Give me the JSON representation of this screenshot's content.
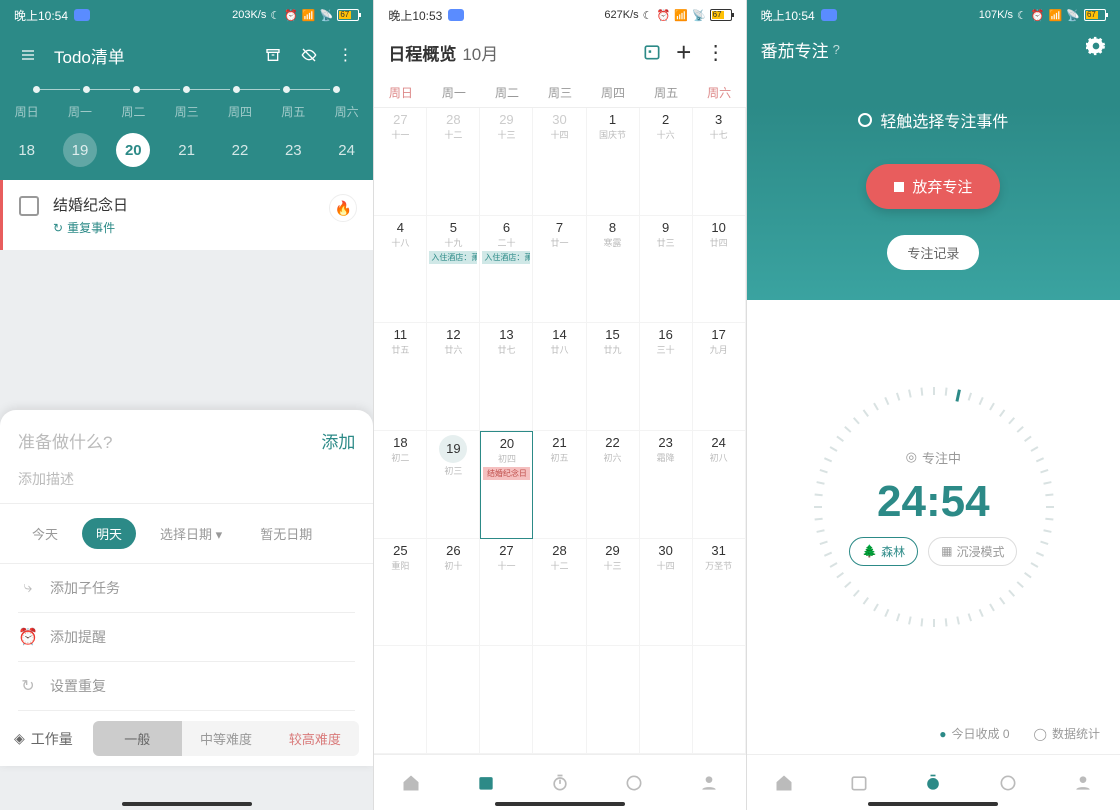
{
  "phone1": {
    "status": {
      "time": "晚上10:54",
      "net": "203K/s"
    },
    "topbar": {
      "title": "Todo清单"
    },
    "weekdays": [
      "周日",
      "周一",
      "周二",
      "周三",
      "周四",
      "周五",
      "周六"
    ],
    "dates": [
      "18",
      "19",
      "20",
      "21",
      "22",
      "23",
      "24"
    ],
    "todo": {
      "title": "结婚纪念日",
      "sub": "重复事件"
    },
    "panel": {
      "placeholder": "准备做什么?",
      "add": "添加",
      "desc": "添加描述",
      "chips": {
        "today": "今天",
        "tomorrow": "明天",
        "pick": "选择日期",
        "none": "暂无日期"
      },
      "opts": {
        "subtask": "添加子任务",
        "reminder": "添加提醒",
        "repeat": "设置重复"
      },
      "workload": {
        "label": "工作量",
        "normal": "一般",
        "medium": "中等难度",
        "high": "较高难度"
      }
    }
  },
  "phone2": {
    "status": {
      "time": "晚上10:53",
      "net": "627K/s"
    },
    "title": "日程概览",
    "month": "10月",
    "weekdays": [
      "周日",
      "周一",
      "周二",
      "周三",
      "周四",
      "周五",
      "周六"
    ],
    "row1": [
      {
        "d": "27",
        "l": "十一",
        "fade": true
      },
      {
        "d": "28",
        "l": "十二",
        "fade": true
      },
      {
        "d": "29",
        "l": "十三",
        "fade": true
      },
      {
        "d": "30",
        "l": "十四",
        "fade": true
      },
      {
        "d": "1",
        "l": "国庆节"
      },
      {
        "d": "2",
        "l": "十六"
      },
      {
        "d": "3",
        "l": "十七"
      }
    ],
    "row2": [
      {
        "d": "4",
        "l": "十八"
      },
      {
        "d": "5",
        "l": "十九",
        "evt": "入住酒店：萧",
        "evtcolor": "teal"
      },
      {
        "d": "6",
        "l": "二十",
        "evt": "入住酒店：萧",
        "evtcolor": "teal"
      },
      {
        "d": "7",
        "l": "廿一"
      },
      {
        "d": "8",
        "l": "寒露"
      },
      {
        "d": "9",
        "l": "廿三"
      },
      {
        "d": "10",
        "l": "廿四"
      }
    ],
    "row3": [
      {
        "d": "11",
        "l": "廿五"
      },
      {
        "d": "12",
        "l": "廿六"
      },
      {
        "d": "13",
        "l": "廿七"
      },
      {
        "d": "14",
        "l": "廿八"
      },
      {
        "d": "15",
        "l": "廿九"
      },
      {
        "d": "16",
        "l": "三十"
      },
      {
        "d": "17",
        "l": "九月"
      }
    ],
    "row4": [
      {
        "d": "18",
        "l": "初二"
      },
      {
        "d": "19",
        "l": "初三",
        "past": true
      },
      {
        "d": "20",
        "l": "初四",
        "today": true,
        "evt": "结婚纪念日",
        "evtcolor": "red"
      },
      {
        "d": "21",
        "l": "初五"
      },
      {
        "d": "22",
        "l": "初六"
      },
      {
        "d": "23",
        "l": "霜降"
      },
      {
        "d": "24",
        "l": "初八"
      }
    ],
    "row5": [
      {
        "d": "25",
        "l": "重阳"
      },
      {
        "d": "26",
        "l": "初十"
      },
      {
        "d": "27",
        "l": "十一"
      },
      {
        "d": "28",
        "l": "十二"
      },
      {
        "d": "29",
        "l": "十三"
      },
      {
        "d": "30",
        "l": "十四"
      },
      {
        "d": "31",
        "l": "万圣节"
      }
    ],
    "row6": [
      {
        "d": "",
        "l": ""
      },
      {
        "d": "",
        "l": ""
      },
      {
        "d": "",
        "l": ""
      },
      {
        "d": "",
        "l": ""
      },
      {
        "d": "",
        "l": ""
      },
      {
        "d": "",
        "l": ""
      },
      {
        "d": "",
        "l": ""
      }
    ]
  },
  "phone3": {
    "status": {
      "time": "晚上10:54",
      "net": "107K/s"
    },
    "title": "番茄专注",
    "touchsel": "轻触选择专注事件",
    "abort": "放弃专注",
    "record": "专注记录",
    "focusing": "专注中",
    "time": "24:54",
    "mode_forest": "森林",
    "mode_immerse": "沉浸模式",
    "today_harvest": "今日收成 0",
    "stats": "数据统计"
  },
  "battery": "67"
}
